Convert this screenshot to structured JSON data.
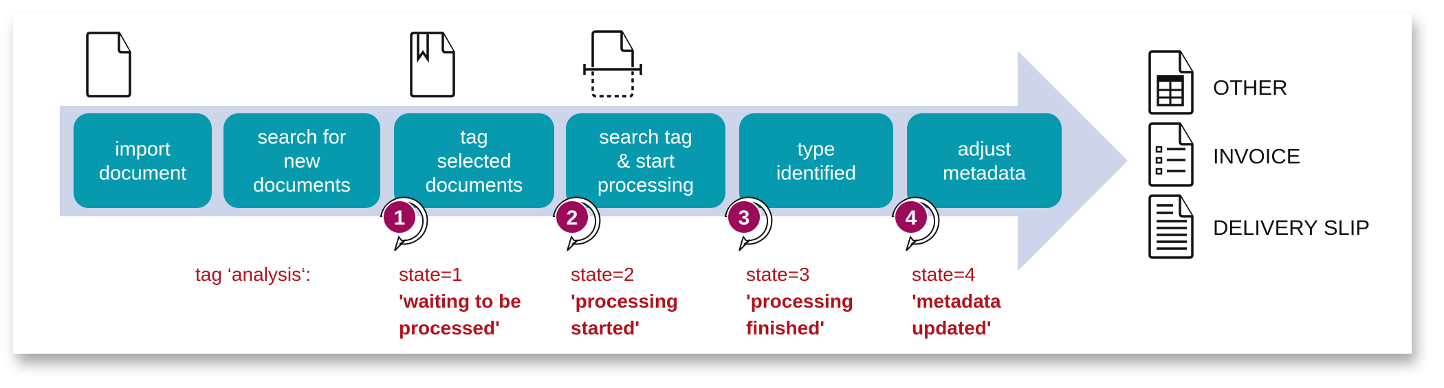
{
  "colors": {
    "band": "#cdd5ea",
    "box": "#079aae",
    "badge": "#9c0a5a",
    "state_text": "#b3111c"
  },
  "steps": [
    {
      "lines": [
        "import",
        "document"
      ]
    },
    {
      "lines": [
        "search for",
        "new",
        "documents"
      ]
    },
    {
      "lines": [
        "tag",
        "selected",
        "documents"
      ]
    },
    {
      "lines": [
        "search tag",
        "& start",
        "processing"
      ]
    },
    {
      "lines": [
        "type",
        "identified"
      ]
    },
    {
      "lines": [
        "adjust",
        "metadata"
      ]
    }
  ],
  "step_icons": [
    "document-icon",
    "bookmarked-document-icon",
    "scan-document-icon"
  ],
  "tag_label": "tag ‘analysis‘:",
  "states": [
    {
      "badge": "1",
      "value": "state=1",
      "desc": [
        "'waiting to be",
        "processed'"
      ]
    },
    {
      "badge": "2",
      "value": "state=2",
      "desc": [
        "'processing",
        "started'"
      ]
    },
    {
      "badge": "3",
      "value": "state=3",
      "desc": [
        "'processing",
        "finished'"
      ]
    },
    {
      "badge": "4",
      "value": "state=4",
      "desc": [
        "'metadata",
        "updated'"
      ]
    }
  ],
  "doc_types": [
    {
      "icon": "table-document-icon",
      "label": "OTHER"
    },
    {
      "icon": "checklist-document-icon",
      "label": "INVOICE"
    },
    {
      "icon": "text-document-icon",
      "label": "DELIVERY SLIP"
    }
  ]
}
